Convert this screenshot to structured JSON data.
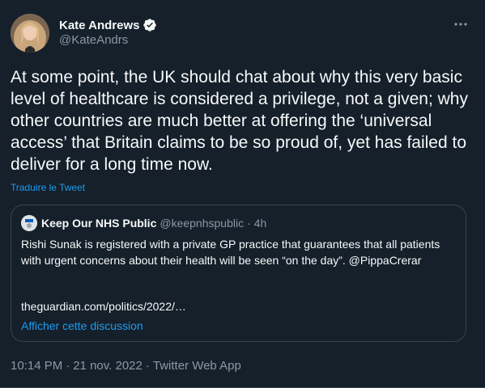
{
  "author": {
    "name": "Kate Andrews",
    "handle": "@KateAndrs",
    "verified": true,
    "verified_color": "#1d9bf0"
  },
  "tweet": {
    "text": "At some point, the UK should chat about why this very basic level of healthcare is considered a privilege, not a given; why other countries are much better at offering the ‘universal access’ that Britain claims to be so proud of, yet has failed to deliver for a long time now.",
    "translate_label": "Traduire le Tweet"
  },
  "quote": {
    "name": "Keep Our NHS Public",
    "handle": "@keepnhspublic",
    "separator": "·",
    "time": "4h",
    "text": "Rishi Sunak is registered with a private GP practice that guarantees that all patients with urgent concerns about their health will be seen “on the day”. @PippaCrerar",
    "link": "theguardian.com/politics/2022/…",
    "show_thread_label": "Afficher cette discussion"
  },
  "meta": {
    "time": "10:14 PM",
    "separator1": "·",
    "date": "21 nov. 2022",
    "separator2": "·",
    "source": "Twitter Web App"
  },
  "icons": {
    "more": "more-options-icon",
    "verified": "verified-badge-icon"
  },
  "colors": {
    "background": "#15202b",
    "text": "#f7f9f9",
    "secondary": "#8b98a5",
    "accent": "#1d9bf0",
    "border": "#38444d"
  }
}
